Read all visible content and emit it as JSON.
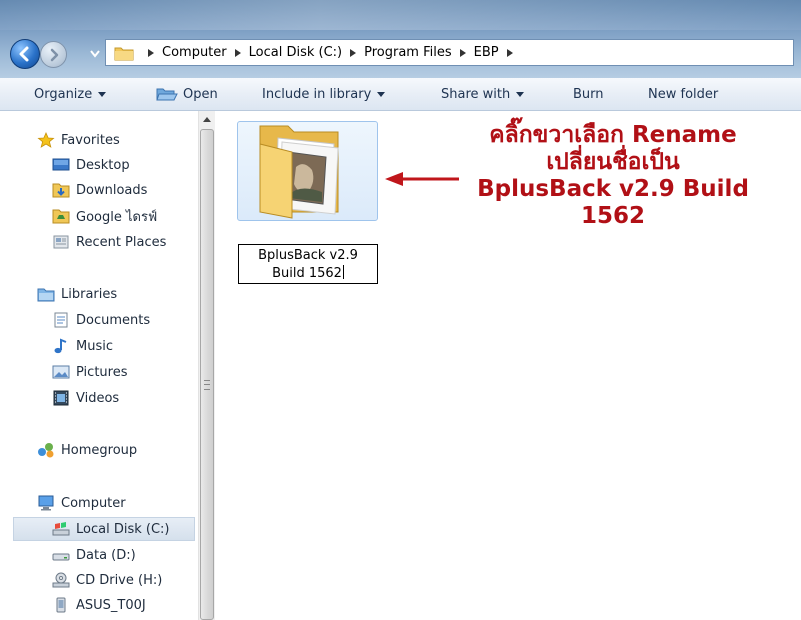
{
  "address": {
    "crumbs": [
      "Computer",
      "Local Disk (C:)",
      "Program Files",
      "EBP"
    ]
  },
  "toolbar": {
    "organize": "Organize",
    "open": "Open",
    "include_in_library": "Include in library",
    "share_with": "Share with",
    "burn": "Burn",
    "new_folder": "New folder"
  },
  "sidebar": {
    "favorites": "Favorites",
    "desktop": "Desktop",
    "downloads": "Downloads",
    "google_drive": "Google ไดรฟ์",
    "recent_places": "Recent Places",
    "libraries": "Libraries",
    "documents": "Documents",
    "music": "Music",
    "pictures": "Pictures",
    "videos": "Videos",
    "homegroup": "Homegroup",
    "computer": "Computer",
    "local_disk": "Local Disk (C:)",
    "data_d": "Data (D:)",
    "cd_drive": "CD Drive (H:)",
    "asus": "ASUS_T00J"
  },
  "content": {
    "rename_line1": "BplusBack v2.9",
    "rename_line2": "Build 1562",
    "annotation": {
      "line1": "คลิ๊กขวาเลือก Rename",
      "line2": "เปลี่ยนชื่อเป็น",
      "line3": "BplusBack v2.9 Build",
      "line4": "1562"
    }
  },
  "colors": {
    "annotation_red": "#b11016",
    "arrow_red": "#c0161b",
    "selection_bg": "#dbe7f5",
    "folder_yellow": "#f3cf6a"
  }
}
